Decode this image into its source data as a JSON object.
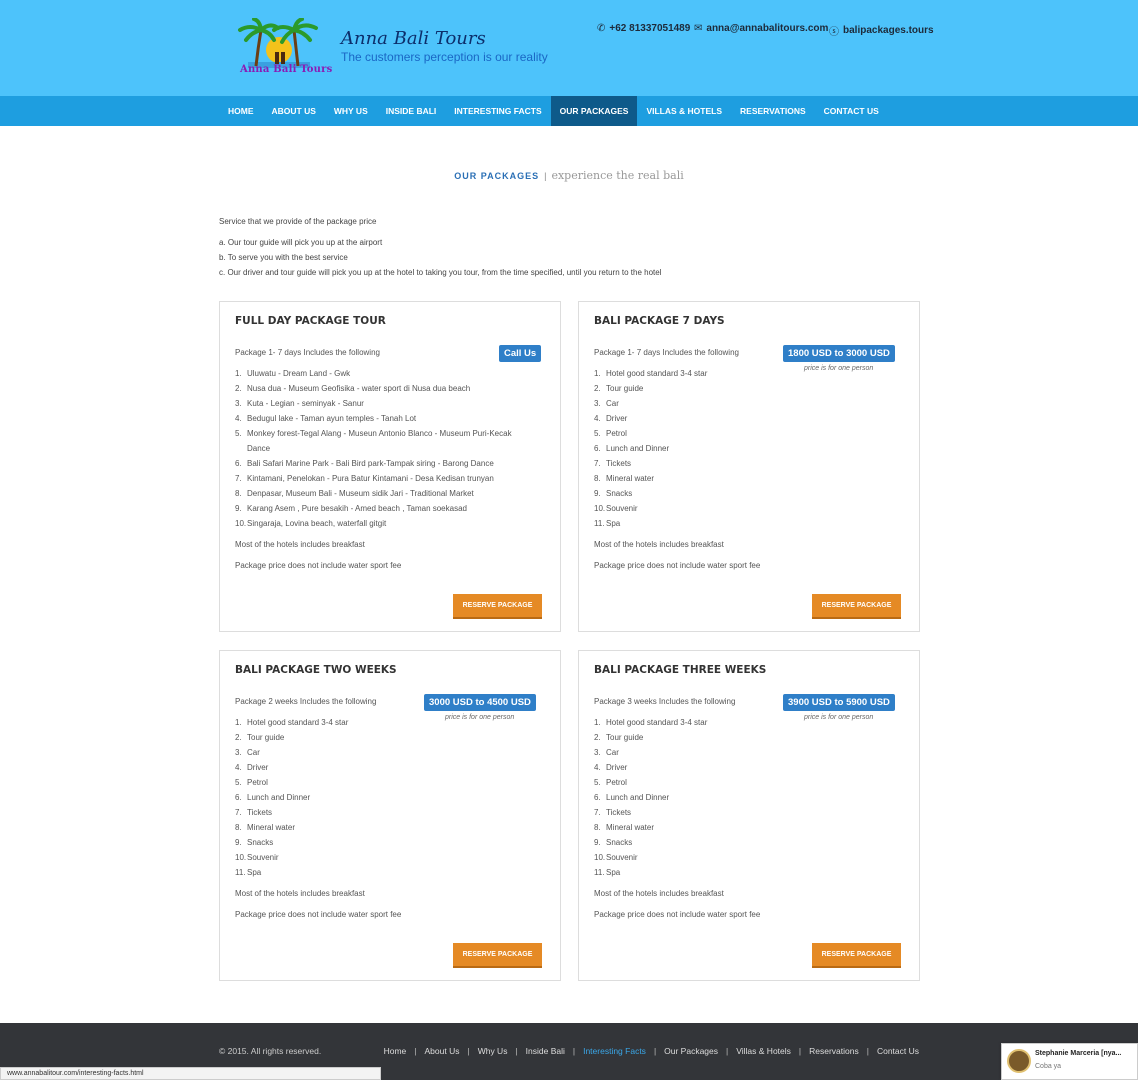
{
  "brand": {
    "logo_text": "Anna Bali Tours",
    "name": "Anna Bali Tours",
    "tagline": "The customers perception is our reality"
  },
  "contact": {
    "phone": "+62 81337051489",
    "email": "anna@annabalitours.com",
    "skype": "balipackages.tours"
  },
  "nav": {
    "items": [
      "HOME",
      "ABOUT US",
      "WHY US",
      "INSIDE BALI",
      "INTERESTING FACTS",
      "OUR PACKAGES",
      "VILLAS & HOTELS",
      "RESERVATIONS",
      "CONTACT US"
    ],
    "active": "OUR PACKAGES"
  },
  "section": {
    "title": "OUR PACKAGES",
    "separator": "|",
    "subtitle": "experience the real bali"
  },
  "intro": {
    "lead": "Service that we provide of the package price",
    "lines": [
      "a. Our tour guide will pick you up at the airport",
      "b. To serve you with the best service",
      "c. Our driver and tour guide will pick you up at the hotel to taking you tour, from the time specified, until you return to the hotel"
    ]
  },
  "cards": [
    {
      "title": "FULL DAY PACKAGE TOUR",
      "sub": "Package 1- 7 days Includes the following",
      "badge": "Call Us",
      "price_note": "",
      "items": [
        "Uluwatu - Dream Land - Gwk",
        "Nusa dua - Museum Geofisika - water sport di Nusa dua beach",
        "Kuta - Legian - seminyak - Sanur",
        "Bedugul lake - Taman ayun temples - Tanah Lot",
        "Monkey forest-Tegal Alang - Museun Antonio Blanco - Museum Puri-Kecak",
        "Dance",
        "Bali Safari Marine Park - Bali Bird park-Tampak siring - Barong Dance",
        "Kintamani, Penelokan - Pura Batur Kintamani - Desa Kedisan trunyan",
        "Denpasar, Museum Bali - Museum sidik Jari - Traditional Market",
        "Karang Asem , Pure besakih - Amed beach , Taman soekasad",
        "Singaraja, Lovina beach, waterfall gitgit"
      ],
      "numbers": [
        "1.",
        "2.",
        "3.",
        "4.",
        "5.",
        "",
        "6.",
        "7.",
        "8.",
        "9.",
        "10."
      ],
      "note1": "Most of the hotels includes breakfast",
      "note2": "Package price does not include water sport fee",
      "button": "RESERVE PACKAGE"
    },
    {
      "title": "BALI PACKAGE 7 DAYS",
      "sub": "Package 1- 7 days Includes the following",
      "badge": "1800 USD to 3000 USD",
      "price_note": "price is for one person",
      "items": [
        "Hotel good standard 3-4 star",
        "Tour guide",
        "Car",
        "Driver",
        "Petrol",
        "Lunch and Dinner",
        "Tickets",
        "Mineral water",
        "Snacks",
        "Souvenir",
        "Spa"
      ],
      "numbers": [
        "1.",
        "2.",
        "3.",
        "4.",
        "5.",
        "6.",
        "7.",
        "8.",
        "9.",
        "10.",
        "11."
      ],
      "note1": "Most of the hotels includes breakfast",
      "note2": "Package price does not include water sport fee",
      "button": "RESERVE PACKAGE"
    },
    {
      "title": "BALI PACKAGE TWO WEEKS",
      "sub": "Package 2 weeks Includes the following",
      "badge": "3000 USD to 4500 USD",
      "price_note": "price is for one person",
      "items": [
        "Hotel good standard 3-4 star",
        "Tour guide",
        "Car",
        "Driver",
        "Petrol",
        "Lunch and Dinner",
        "Tickets",
        "Mineral water",
        "Snacks",
        "Souvenir",
        "Spa"
      ],
      "numbers": [
        "1.",
        "2.",
        "3.",
        "4.",
        "5.",
        "6.",
        "7.",
        "8.",
        "9.",
        "10.",
        "11."
      ],
      "note1": "Most of the hotels includes breakfast",
      "note2": "Package price does not include water sport fee",
      "button": "RESERVE PACKAGE"
    },
    {
      "title": "BALI PACKAGE THREE WEEKS",
      "sub": "Package 3 weeks Includes the following",
      "badge": "3900 USD to 5900 USD",
      "price_note": "price is for one person",
      "items": [
        "Hotel good standard 3-4 star",
        "Tour guide",
        "Car",
        "Driver",
        "Petrol",
        "Lunch and Dinner",
        "Tickets",
        "Mineral water",
        "Snacks",
        "Souvenir",
        "Spa"
      ],
      "numbers": [
        "1.",
        "2.",
        "3.",
        "4.",
        "5.",
        "6.",
        "7.",
        "8.",
        "9.",
        "10.",
        "11."
      ],
      "note1": "Most of the hotels includes breakfast",
      "note2": "Package price does not include water sport fee",
      "button": "RESERVE PACKAGE"
    }
  ],
  "footer": {
    "copyright": "© 2015. All rights reserved.",
    "links": [
      "Home",
      "About Us",
      "Why Us",
      "Inside Bali",
      "Interesting Facts",
      "Our Packages",
      "Villas & Hotels",
      "Reservations",
      "Contact Us"
    ],
    "highlighted": "Interesting Facts"
  },
  "status_bar": {
    "url": "www.annabalitour.com/interesting-facts.html"
  },
  "chat": {
    "name": "Stephanie Marceria [nya...",
    "message": "Coba ya"
  },
  "colors": {
    "header_bg": "#4dc3fb",
    "nav_bg": "#1e9ee0",
    "nav_active": "#0e5a8a",
    "badge": "#2f7fc8",
    "button": "#e58a25",
    "footer_bg": "#333539"
  }
}
